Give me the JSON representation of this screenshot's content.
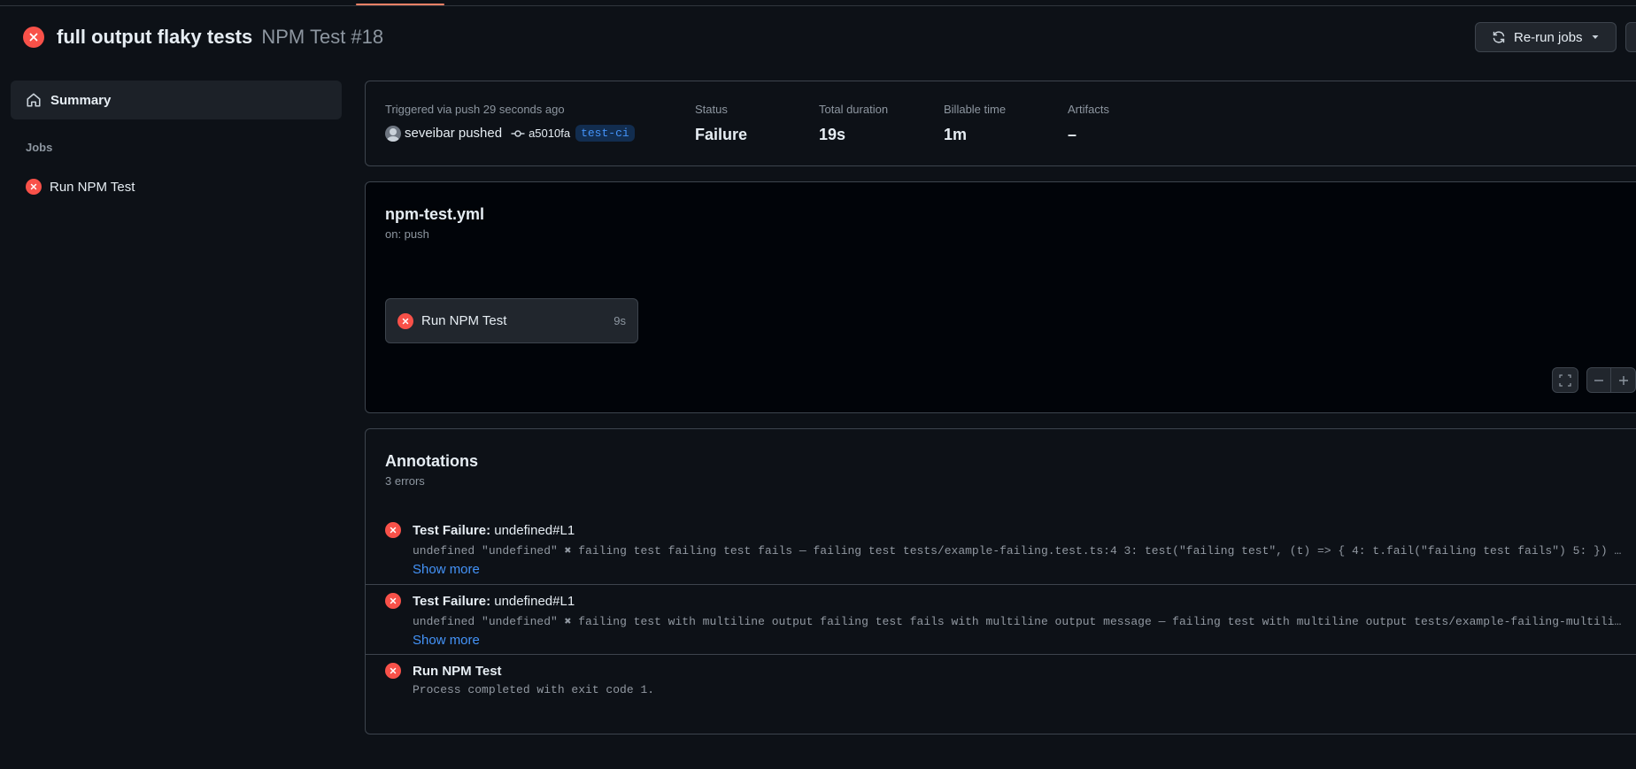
{
  "header": {
    "workflow_title": "full output flaky tests",
    "run_label": "NPM Test #18",
    "rerun_label": "Re-run jobs"
  },
  "sidebar": {
    "summary_label": "Summary",
    "jobs_heading": "Jobs",
    "jobs": [
      {
        "label": "Run NPM Test",
        "status": "failure"
      }
    ]
  },
  "summary": {
    "trigger_text": "Triggered via push 29 seconds ago",
    "actor": "seveibar pushed",
    "commit_sha": "a5010fa",
    "branch": "test-ci",
    "status_label": "Status",
    "status_value": "Failure",
    "duration_label": "Total duration",
    "duration_value": "19s",
    "billable_label": "Billable time",
    "billable_value": "1m",
    "artifacts_label": "Artifacts",
    "artifacts_value": "–"
  },
  "graph": {
    "file_name": "npm-test.yml",
    "trigger": "on: push",
    "job_name": "Run NPM Test",
    "job_duration": "9s"
  },
  "annotations": {
    "title": "Annotations",
    "count": "3 errors",
    "items": [
      {
        "title": "Test Failure:",
        "location": "undefined#L1",
        "body": "undefined \"undefined\" ✖ failing test failing test fails — failing test tests/example-failing.test.ts:4 3: test(\"failing test\", (t) => { 4: t.fail(\"failing test fails\") 5: }) …",
        "more": "Show more"
      },
      {
        "title": "Test Failure:",
        "location": "undefined#L1",
        "body": "undefined \"undefined\" ✖ failing test with multiline output failing test fails with multiline output message — failing test with multiline output tests/example-failing-multili…",
        "more": "Show more"
      },
      {
        "title": "Run NPM Test",
        "location": "",
        "body": "Process completed with exit code 1.",
        "more": ""
      }
    ]
  },
  "colors": {
    "background": "#0d1117",
    "failure": "#f85149",
    "link": "#4493f8",
    "muted_text": "#8d96a0",
    "border": "#3d444d",
    "active_tab": "#f78166"
  },
  "icons": [
    "x-circle-icon",
    "sync-icon",
    "triangle-down-icon",
    "kebab-icon",
    "home-icon",
    "git-commit-icon",
    "screen-full-icon",
    "dash-icon",
    "plus-icon"
  ]
}
